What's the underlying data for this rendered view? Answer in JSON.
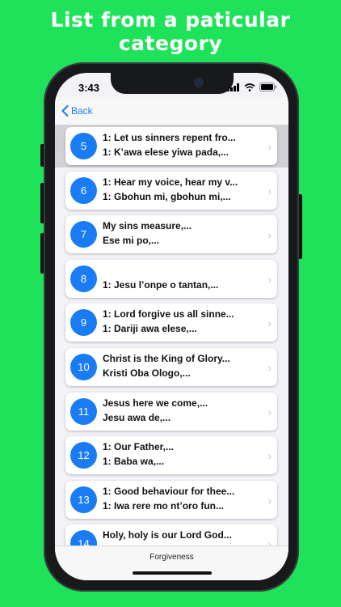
{
  "headline": {
    "line1": "List from a paticular",
    "line2": "category"
  },
  "status": {
    "time": "3:43",
    "icons": [
      "signal-icon",
      "wifi-icon",
      "battery-icon"
    ]
  },
  "nav": {
    "back_label": "Back",
    "back_icon": "chevron-left-icon"
  },
  "tab": {
    "label": "Forgiveness"
  },
  "colors": {
    "background": "#1ee35a",
    "accent": "#1a7cf5",
    "selected_row": "#d1d1d6"
  },
  "hymns": [
    {
      "number": "5",
      "line1": "1: Let us sinners repent fro...",
      "line2": "1: K’awa elese yiwa pada,...",
      "selected": true
    },
    {
      "number": "6",
      "line1": "1: Hear my voice, hear my v...",
      "line2": "1: Gbohun mi, gbohun mi,..."
    },
    {
      "number": "7",
      "line1": "My sins measure,...",
      "line2": "Ese mi po,..."
    },
    {
      "number": "8",
      "line1": "",
      "line2": "1: Jesu l’onpe o tantan,..."
    },
    {
      "number": "9",
      "line1": "1: Lord forgive us all sinne...",
      "line2": "1: Dariji awa elese,..."
    },
    {
      "number": "10",
      "line1": "Christ is the King of Glory...",
      "line2": "Kristi Oba Ologo,..."
    },
    {
      "number": "11",
      "line1": "Jesus here we come,...",
      "line2": "Jesu awa de,..."
    },
    {
      "number": "12",
      "line1": "1: Our Father,...",
      "line2": "1: Baba wa,..."
    },
    {
      "number": "13",
      "line1": "1: Good behaviour for thee...",
      "line2": "1: Iwa rere mo nt’oro fun..."
    },
    {
      "number": "14",
      "line1": "Holy, holy is our Lord God...",
      "line2": ""
    }
  ]
}
